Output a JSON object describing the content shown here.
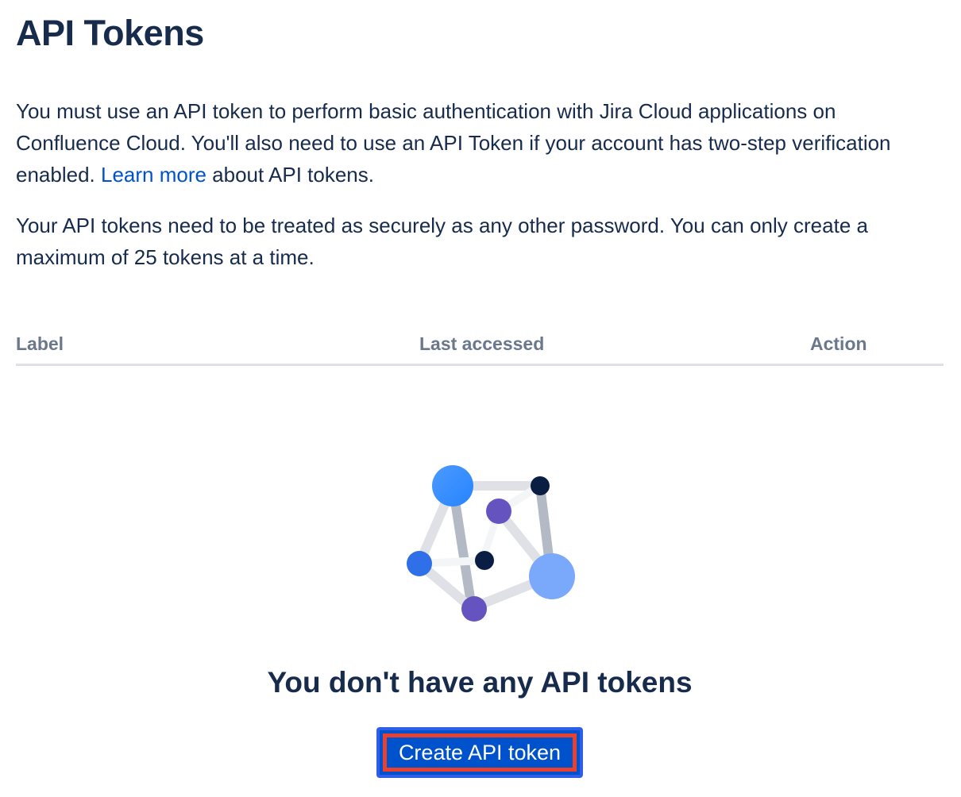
{
  "page": {
    "title": "API Tokens"
  },
  "intro": {
    "text_before_link": "You must use an API token to perform basic authentication with Jira Cloud applications on Confluence Cloud. You'll also need to use an API Token if your account has two-step verification enabled. ",
    "link_text": "Learn more",
    "text_after_link": " about API tokens."
  },
  "security_note": "Your API tokens need to be treated as securely as any other password. You can only create a maximum of 25 tokens at a time.",
  "table": {
    "columns": [
      "Label",
      "Last accessed",
      "Action"
    ],
    "rows": []
  },
  "empty_state": {
    "icon": "network-nodes-illustration",
    "heading": "You don't have any API tokens",
    "button_label": "Create API token"
  },
  "colors": {
    "text": "#172b4d",
    "link": "#0052cc",
    "header_text": "#6b778c",
    "button_bg": "#0052cc",
    "highlight_outline": "#e8412f"
  }
}
